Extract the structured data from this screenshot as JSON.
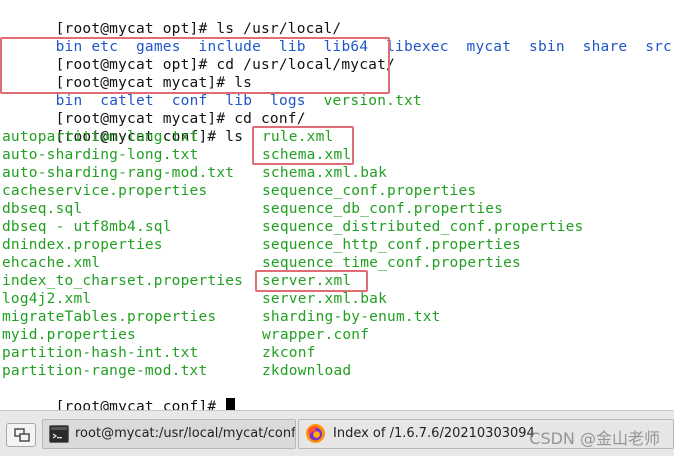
{
  "terminal": {
    "lines": [
      {
        "prompt": "[root@mycat opt]# ",
        "command": "ls /usr/local/"
      },
      {
        "listing": [
          "bin",
          "etc",
          "games",
          "include",
          "lib",
          "lib64",
          "libexec",
          "mycat",
          "sbin",
          "share",
          "src"
        ]
      },
      {
        "prompt": "[root@mycat opt]# ",
        "command": "cd /usr/local/mycat/"
      },
      {
        "prompt": "[root@mycat mycat]# ",
        "command": "ls"
      },
      {
        "listing_blue": [
          "bin",
          "catlet",
          "conf",
          "lib",
          "logs"
        ],
        "listing_green": [
          "version.txt"
        ]
      },
      {
        "prompt": "[root@mycat mycat]# ",
        "command": "cd conf/"
      },
      {
        "prompt": "[root@mycat conf]# ",
        "command": "ls"
      }
    ],
    "files_col1": [
      "autopartition-long.txt",
      "auto-sharding-long.txt",
      "auto-sharding-rang-mod.txt",
      "cacheservice.properties",
      "dbseq.sql",
      "dbseq - utf8mb4.sql",
      "dnindex.properties",
      "ehcache.xml",
      "index_to_charset.properties",
      "log4j2.xml",
      "migrateTables.properties",
      "myid.properties",
      "partition-hash-int.txt",
      "partition-range-mod.txt"
    ],
    "files_col2": [
      "rule.xml",
      "schema.xml",
      "schema.xml.bak",
      "sequence_conf.properties",
      "sequence_db_conf.properties",
      "sequence_distributed_conf.properties",
      "sequence_http_conf.properties",
      "sequence_time_conf.properties",
      "server.xml",
      "server.xml.bak",
      "sharding-by-enum.txt",
      "wrapper.conf",
      "zkconf",
      "zkdownload"
    ],
    "last_prompt": "[root@mycat conf]# "
  },
  "taskbar": {
    "terminal_task": "root@mycat:/usr/local/mycat/conf",
    "browser_task": "Index of /1.6.7.6/20210303094",
    "watermark": "CSDN @金山老师"
  },
  "colors": {
    "directory": "#1f56c9",
    "file": "#22a022",
    "highlight": "#e06c75"
  }
}
